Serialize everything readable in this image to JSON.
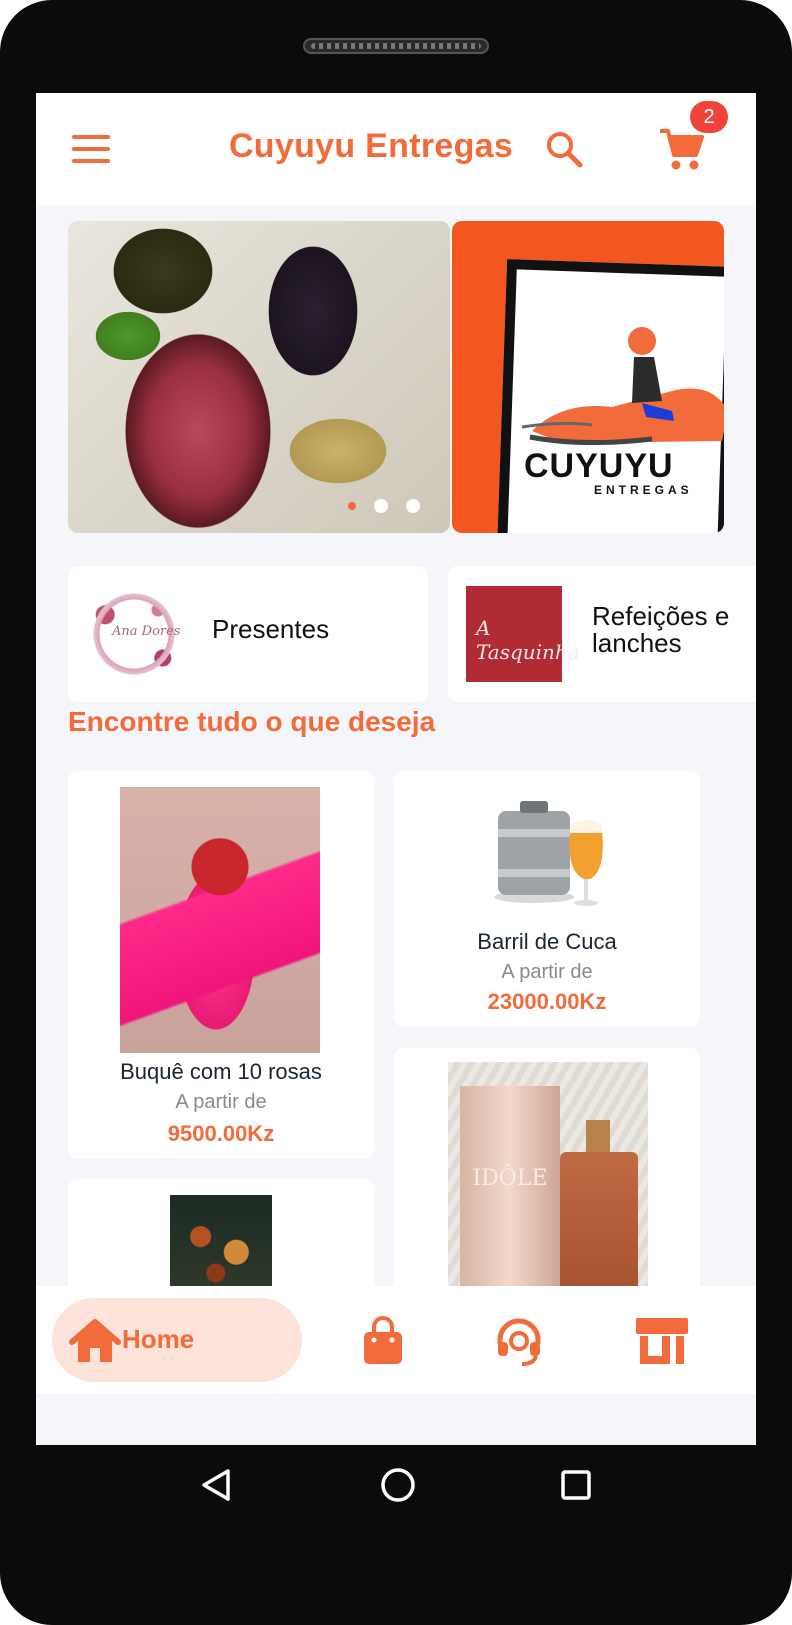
{
  "header": {
    "title": "Cuyuyu Entregas",
    "cart_count": "2"
  },
  "carousel": {
    "slides": [
      "slide-food",
      "slide-logo"
    ],
    "logo_text": "CUYUYU",
    "logo_sub": "ENTREGAS",
    "active_index": 0
  },
  "categories": [
    {
      "label": "Presentes",
      "image_text": "Ana Dores"
    },
    {
      "label": "Refeições e lanches",
      "image_text": "A Tasquinha"
    }
  ],
  "section": {
    "title": "Encontre tudo o que deseja"
  },
  "products": [
    {
      "name": "Buquê com 10 rosas",
      "from": "A partir de",
      "price": "9500.00Kz"
    },
    {
      "name": "Barril de Cuca",
      "from": "A partir de",
      "price": "23000.00Kz"
    },
    {
      "name": "",
      "from": "",
      "price": ""
    },
    {
      "name": "",
      "from": "",
      "price": "",
      "image_text": "IDÔLE"
    }
  ],
  "bottom_nav": {
    "home_label": "Home",
    "icons": [
      "home-icon",
      "bag-icon",
      "headset-icon",
      "store-icon"
    ]
  },
  "colors": {
    "accent": "#f26b3a",
    "badge": "#f0443a",
    "home_pill": "#fde3da",
    "background": "#f5f6fa"
  }
}
